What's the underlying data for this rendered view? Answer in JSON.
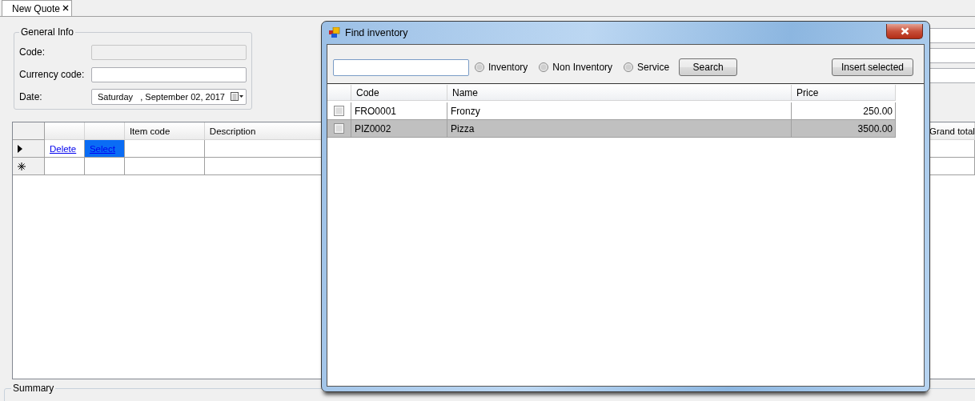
{
  "tab": {
    "label": "New Quote",
    "selected": true
  },
  "general_info": {
    "title": "General Info",
    "fields": [
      {
        "label": "Code:",
        "kind": "text",
        "disabled": true
      },
      {
        "label": "Currency code:",
        "kind": "text",
        "disabled": false
      },
      {
        "label": "Date:",
        "kind": "date",
        "value": "Saturday   , September 02, 2017"
      }
    ]
  },
  "grid": {
    "columns": {
      "item_code": "Item code",
      "description": "Description",
      "grand_total": "Grand total"
    },
    "rows": [
      {
        "kind": "current",
        "cells": [
          {
            "text": "Delete",
            "selected": false
          },
          {
            "text": "Select",
            "selected": true
          }
        ]
      },
      {
        "kind": "new"
      }
    ]
  },
  "summary": {
    "title": "Summary"
  },
  "dialog": {
    "title": "Find inventory",
    "filters": [
      {
        "label": "Inventory",
        "selected": false
      },
      {
        "label": "Non Inventory",
        "selected": false
      },
      {
        "label": "Service",
        "selected": false
      }
    ],
    "search_button": "Search",
    "insert_button": "Insert selected",
    "table": {
      "columns": [
        "Code",
        "Name",
        "Price"
      ],
      "rows": [
        {
          "checked": false,
          "selected": false,
          "code": "FRO0001",
          "name": "Fronzy",
          "price": "250.00"
        },
        {
          "checked": false,
          "selected": true,
          "code": "PIZ0002",
          "name": "Pizza",
          "price": "3500.00"
        }
      ]
    }
  }
}
